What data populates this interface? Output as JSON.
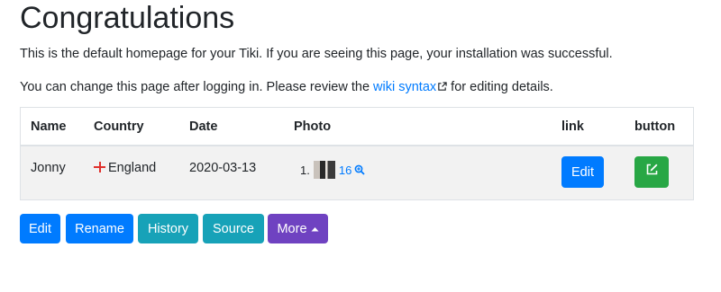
{
  "heading": "Congratulations",
  "intro": "This is the default homepage for your Tiki. If you are seeing this page, your installation was successful.",
  "change_line": {
    "before": "You can change this page after logging in. Please review the ",
    "link": "wiki syntax",
    "after": " for editing details."
  },
  "table": {
    "headers": [
      "Name",
      "Country",
      "Date",
      "Photo",
      "link",
      "button"
    ],
    "row": {
      "name": "Jonny",
      "country": "England",
      "date": "2020-03-13",
      "photo_index": "1.",
      "photo_count": "16",
      "link_button": "Edit"
    }
  },
  "actions": {
    "edit": "Edit",
    "rename": "Rename",
    "history": "History",
    "source": "Source",
    "more": "More"
  },
  "icons": {
    "external": "external-link-icon",
    "flag": "england-flag-icon",
    "zoom": "zoom-in-icon",
    "edit": "edit-square-icon",
    "caret": "caret-up-icon"
  },
  "colors": {
    "primary": "#007bff",
    "info": "#17a2b8",
    "purple": "#6f42c1",
    "success": "#28a745",
    "flag_red": "#e0302c",
    "row_bg": "#f2f2f2"
  }
}
